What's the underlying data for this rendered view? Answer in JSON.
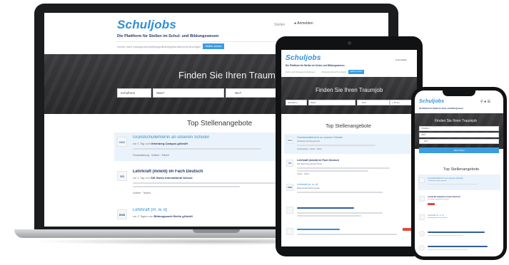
{
  "site": {
    "logo": "Schuljobs",
    "tagline": "Die Plattform für Stellen im Schul- und Bildungswesen",
    "login": "Anmelden",
    "nav_left": "Stellen",
    "subnav": [
      "Suche nach Managementstellungen",
      "Arbeitgeberübersicht anzeigen"
    ],
    "subnav_button": "Stellen suchen"
  },
  "hero": {
    "title": "Finden Sie Ihren Traumjob",
    "field_type": "Schulform",
    "field_what": "Was?",
    "field_where": "Wo?",
    "field_radius": "+ 15 km",
    "search_button": "Jobs finden"
  },
  "section": {
    "title": "Top Stellenangebote"
  },
  "jobs": [
    {
      "title": "Grundschullehrer/in an unseren Schulen",
      "employer": "Ortenberg Campus gGmbH",
      "employer_prefix": "vor 1 Tag von",
      "meta": "Festanstellung · Vollzeit · Teilzeit",
      "logo": "OCG"
    },
    {
      "title": "Lehrkraft (m/w/d) im Fach Deutsch",
      "employer": "SIS Swiss International School",
      "employer_prefix": "vor 1 Tag von",
      "meta": "Vollzeit · Teilzeit",
      "logo": "SIS"
    },
    {
      "title": "Lehrkraft (m, w, d)",
      "employer": "Bildungswerk Berlin gGmbH",
      "employer_prefix": "vor 2 Tagen von",
      "meta": "",
      "logo": "BWB"
    }
  ],
  "phone": {
    "title": "Finden Sie Ihren Traumjob",
    "section": "Top Stellenangebote"
  },
  "colors": {
    "brand": "#2f8fd8",
    "accent": "#3b9ce2",
    "hero": "#3a3a3c",
    "badge": "#e04a3f"
  }
}
